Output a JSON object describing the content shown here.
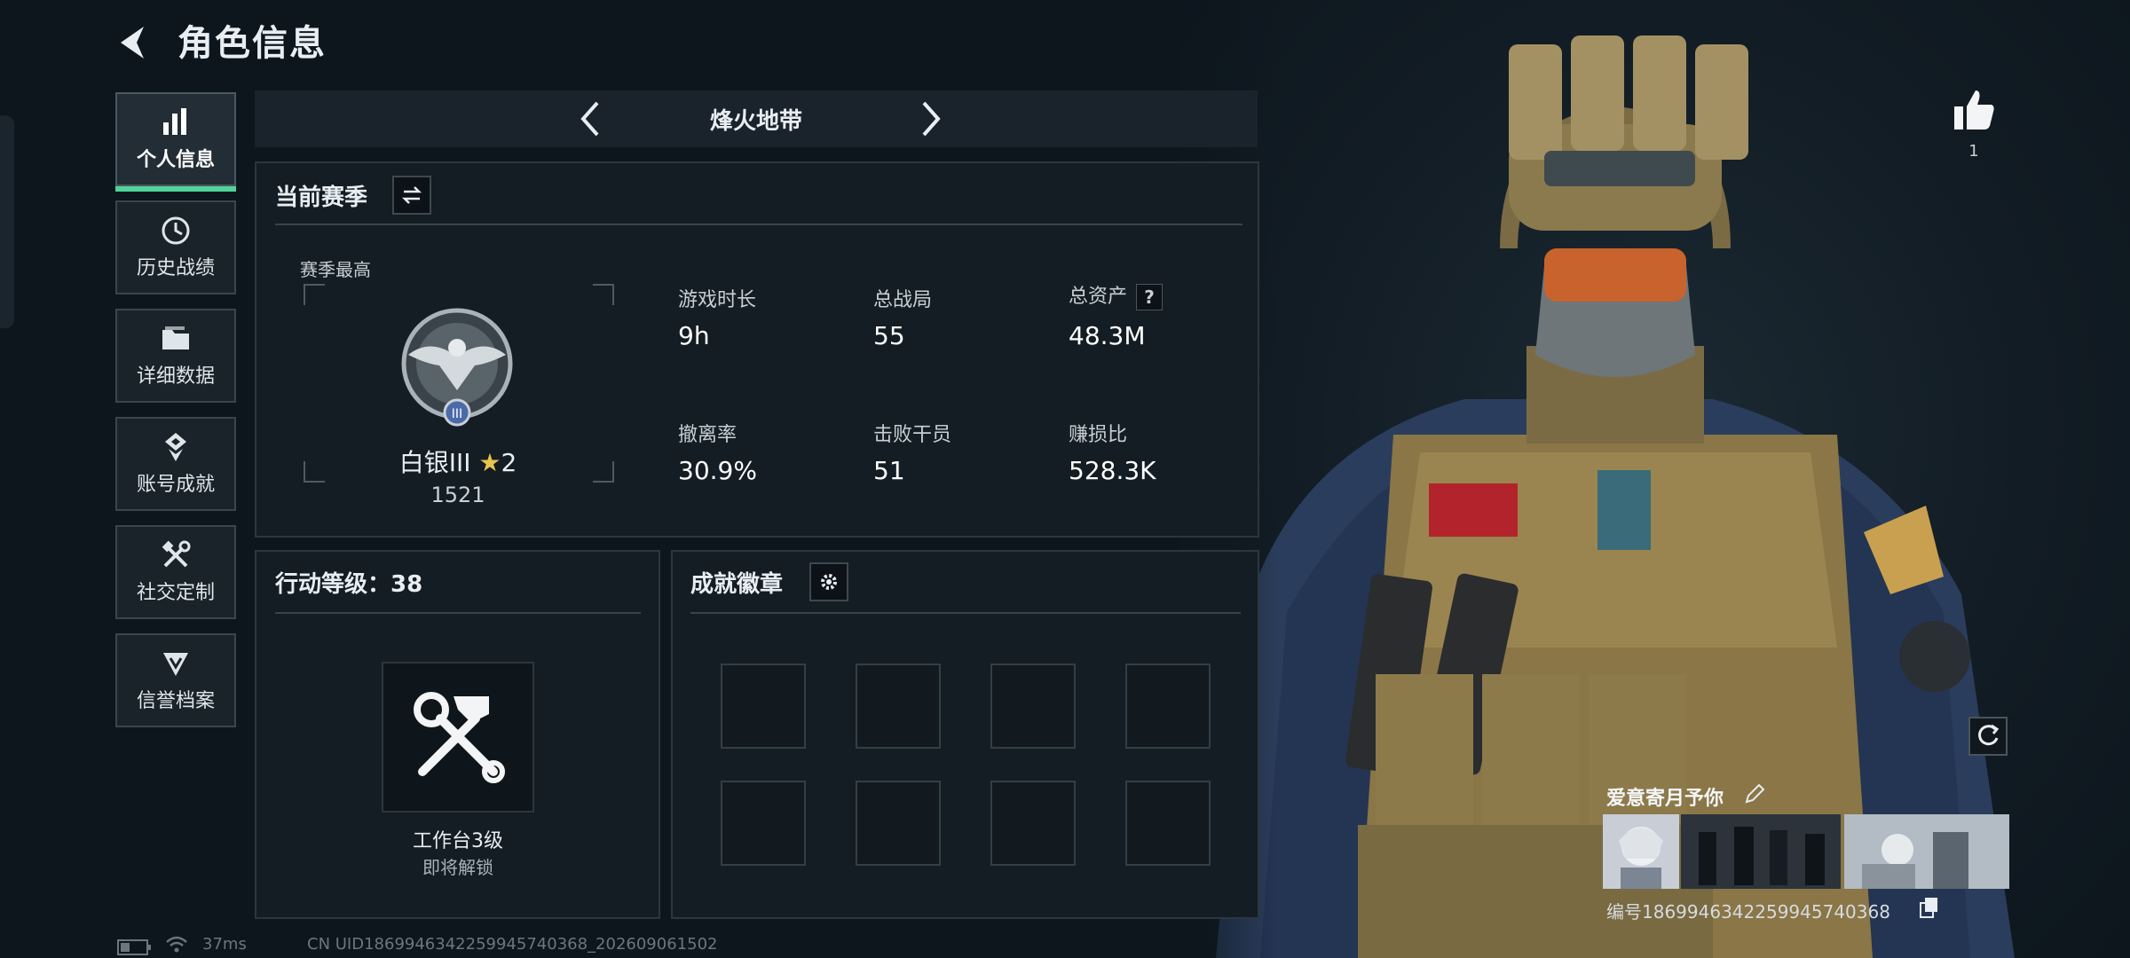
{
  "header": {
    "title": "角色信息"
  },
  "sidebar": {
    "items": [
      {
        "label": "个人信息",
        "icon": "bar-chart-icon",
        "active": true
      },
      {
        "label": "历史战绩",
        "icon": "clock-history-icon"
      },
      {
        "label": "详细数据",
        "icon": "folder-icon"
      },
      {
        "label": "账号成就",
        "icon": "medal-icon"
      },
      {
        "label": "社交定制",
        "icon": "tools-icon"
      },
      {
        "label": "信誉档案",
        "icon": "shield-icon"
      }
    ]
  },
  "mode": {
    "name": "烽火地带"
  },
  "season": {
    "title": "当前赛季",
    "best_label": "赛季最高",
    "rank_name": "白银III",
    "rank_stars": "2",
    "rank_score": "1521",
    "badge_numeral": "III",
    "stats": [
      {
        "label": "游戏时长",
        "value": "9h"
      },
      {
        "label": "总战局",
        "value": "55"
      },
      {
        "label": "总资产",
        "value": "48.3M",
        "help": "?"
      },
      {
        "label": "撤离率",
        "value": "30.9%"
      },
      {
        "label": "击败干员",
        "value": "51"
      },
      {
        "label": "赚损比",
        "value": "528.3K"
      }
    ]
  },
  "action_level": {
    "title": "行动等级：38",
    "item_name": "工作台3级",
    "item_status": "即将解锁"
  },
  "achievements": {
    "title": "成就徽章",
    "slot_count": 8
  },
  "character": {
    "likes": "1",
    "card_name": "爱意寄月予你",
    "card_id": "编号1869946342259945740368"
  },
  "status_bar": {
    "ping": "37ms",
    "uid": "CN UID1869946342259945740368_202609061502"
  },
  "colors": {
    "accent": "#4fd39a",
    "panel": "#141d24",
    "background": "#0d161d"
  }
}
